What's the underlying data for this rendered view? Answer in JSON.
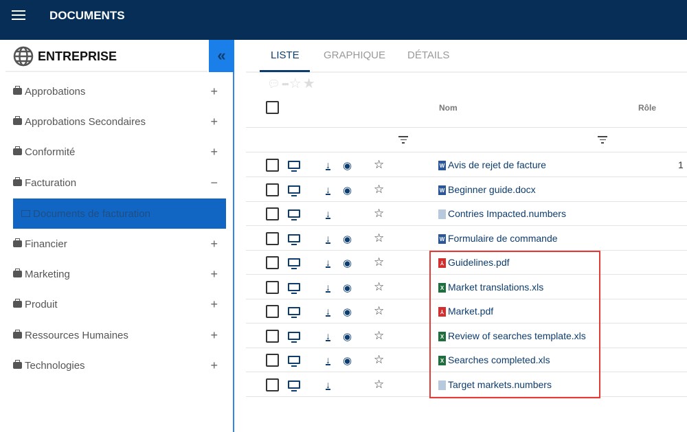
{
  "header": {
    "title": "DOCUMENTS"
  },
  "sidebar": {
    "title": "ENTREPRISE",
    "collapse": "«",
    "items": [
      {
        "label": "Approbations",
        "toggle": "+"
      },
      {
        "label": "Approbations Secondaires",
        "toggle": "+"
      },
      {
        "label": "Conformité",
        "toggle": "+"
      },
      {
        "label": "Facturation",
        "toggle": "−"
      },
      {
        "label": "Financier",
        "toggle": "+"
      },
      {
        "label": "Marketing",
        "toggle": "+"
      },
      {
        "label": "Produit",
        "toggle": "+"
      },
      {
        "label": "Ressources Humaines",
        "toggle": "+"
      },
      {
        "label": "Technologies",
        "toggle": "+"
      }
    ],
    "selected": "Documents de facturation"
  },
  "tabs": [
    "LISTE",
    "GRAPHIQUE",
    "DÉTAILS"
  ],
  "table": {
    "headers": {
      "name": "Nom",
      "role": "Rôle"
    },
    "rows": [
      {
        "name": "Avis de rejet de facture",
        "type": "word",
        "preview": true,
        "role": "1"
      },
      {
        "name": "Beginner guide.docx",
        "type": "word",
        "preview": true,
        "role": ""
      },
      {
        "name": "Contries Impacted.numbers",
        "type": "generic",
        "preview": false,
        "role": ""
      },
      {
        "name": "Formulaire de commande",
        "type": "word",
        "preview": true,
        "role": ""
      },
      {
        "name": "Guidelines.pdf",
        "type": "pdf",
        "preview": true,
        "role": ""
      },
      {
        "name": "Market translations.xls",
        "type": "excel",
        "preview": true,
        "role": ""
      },
      {
        "name": "Market.pdf",
        "type": "pdf",
        "preview": true,
        "role": ""
      },
      {
        "name": "Review of searches template.xls",
        "type": "excel",
        "preview": true,
        "role": ""
      },
      {
        "name": "Searches completed.xls",
        "type": "excel",
        "preview": true,
        "role": ""
      },
      {
        "name": "Target markets.numbers",
        "type": "generic",
        "preview": false,
        "role": ""
      }
    ]
  },
  "colors": {
    "header": "#062e56",
    "accent": "#1a7fe8",
    "word": "#2b579a",
    "pdf": "#d32f2f",
    "excel": "#1e6e3e",
    "generic": "#b7c9dc",
    "highlight": "#e53935"
  }
}
